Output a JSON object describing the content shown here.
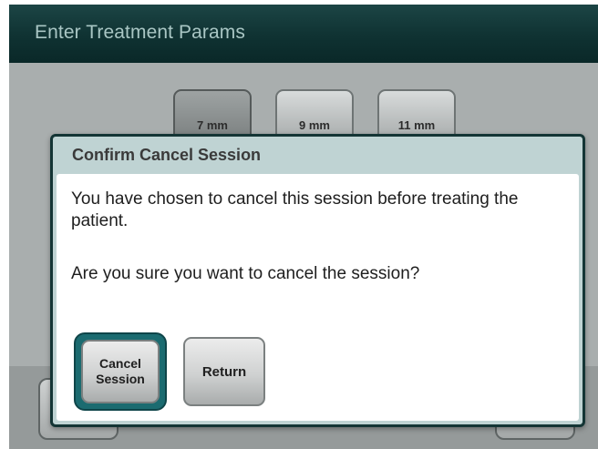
{
  "header": {
    "title": "Enter Treatment Params"
  },
  "sizes": [
    {
      "label": "7 mm",
      "selected": true
    },
    {
      "label": "9 mm",
      "selected": false
    },
    {
      "label": "11 mm",
      "selected": false
    }
  ],
  "dialog": {
    "title": "Confirm Cancel Session",
    "message": "You have chosen to cancel this session before treating the patient.",
    "question": "Are you sure you want to cancel the session?",
    "cancel_label": "Cancel Session",
    "return_label": "Return"
  },
  "colors": {
    "header_bg": "#0f3232",
    "header_text": "#a9c6c4",
    "dialog_title_bg": "#bfd3d3",
    "selected_button_ring": "#1b6b70"
  }
}
